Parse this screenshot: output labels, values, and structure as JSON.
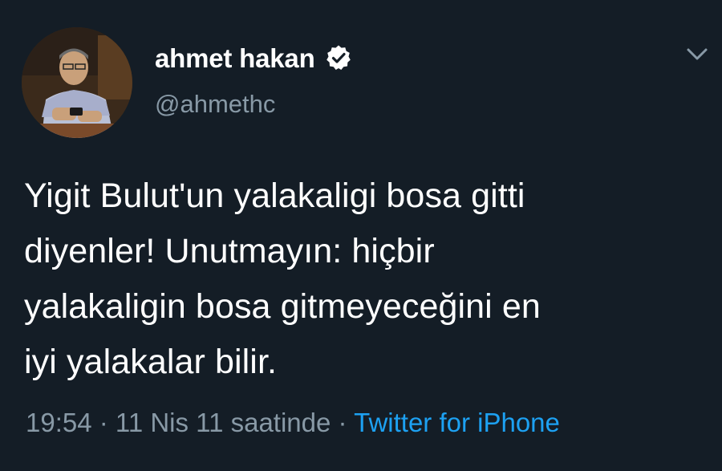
{
  "author": {
    "display_name": "ahmet hakan",
    "handle": "@ahmethc",
    "verified": true,
    "avatar_icon": "profile-photo"
  },
  "tweet": {
    "lines": [
      "Yigit Bulut'un yalakaligi bosa gitti",
      "diyenler! Unutmayın: hiçbir",
      "yalakaligin bosa gitmeyeceğini en",
      "iyi yalakalar bilir."
    ]
  },
  "meta": {
    "time": "19:54",
    "separator": " · ",
    "date": "11 Nis 11 saatinde",
    "source": "Twitter for iPhone"
  },
  "menu": {
    "icon": "chevron-down-icon"
  },
  "colors": {
    "background": "#141d26",
    "secondary_text": "#8899a6",
    "accent": "#1da1f2"
  }
}
